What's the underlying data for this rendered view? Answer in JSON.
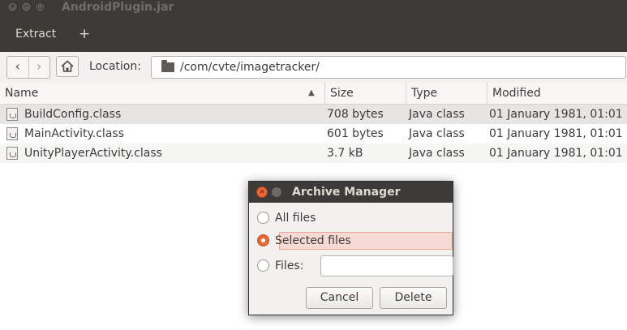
{
  "window": {
    "title": "AndroidPlugin.jar",
    "close_glyph": "×",
    "min_glyph": "−",
    "max_glyph": "□"
  },
  "toolbar": {
    "extract_label": "Extract",
    "add_label": "+"
  },
  "location": {
    "back_glyph": "‹",
    "forward_glyph": "›",
    "label": "Location:",
    "path": "/com/cvte/imagetracker/"
  },
  "table": {
    "columns": {
      "name": "Name",
      "size": "Size",
      "type": "Type",
      "modified": "Modified"
    },
    "sort_glyph": "▲",
    "rows": [
      {
        "name": "BuildConfig.class",
        "size": "708 bytes",
        "type": "Java class",
        "modified": "01 January 1981, 01:01"
      },
      {
        "name": "MainActivity.class",
        "size": "601 bytes",
        "type": "Java class",
        "modified": "01 January 1981, 01:01"
      },
      {
        "name": "UnityPlayerActivity.class",
        "size": "3.7 kB",
        "type": "Java class",
        "modified": "01 January 1981, 01:01"
      }
    ]
  },
  "dialog": {
    "title": "Archive Manager",
    "close_glyph": "×",
    "options": {
      "all": "All files",
      "selected": "Selected files",
      "files": "Files:"
    },
    "selected_option": "selected",
    "files_value": "",
    "cancel_label": "Cancel",
    "delete_label": "Delete"
  },
  "colors": {
    "titlebar": "#3c3b37",
    "accent": "#e66a37",
    "selection": "#e6e5e3"
  }
}
